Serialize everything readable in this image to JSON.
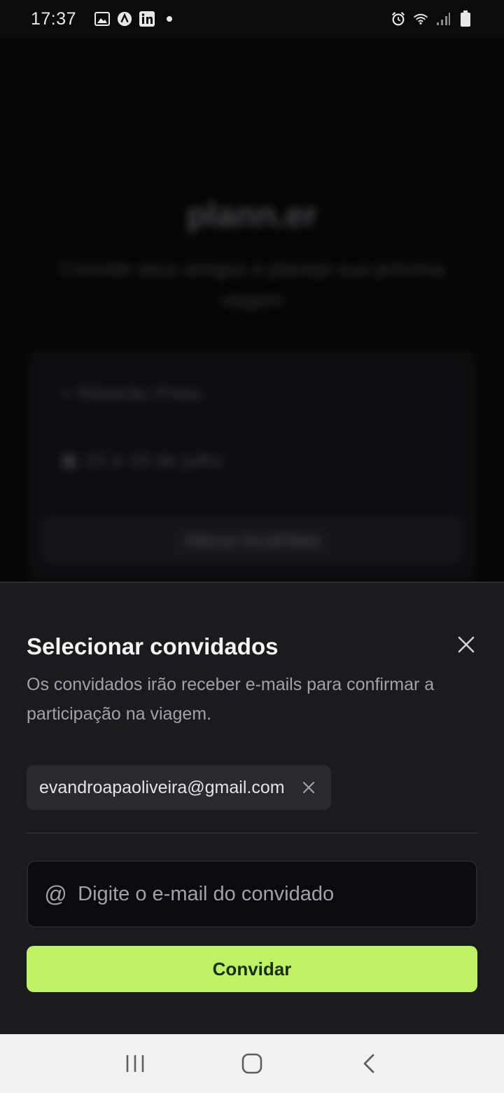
{
  "status_bar": {
    "time": "17:37",
    "left_icons": [
      "image-icon",
      "app-icon",
      "linkedin-icon",
      "dot-icon"
    ],
    "right_icons": [
      "alarm-icon",
      "wifi-icon",
      "signal-icon",
      "battery-icon"
    ]
  },
  "background_app": {
    "logo_text": "plann.er",
    "subtitle": "Convide seus amigos e planeje sua próxima viagem",
    "destination": "Ribeirão Preto",
    "dates": "15 à 18 de julho",
    "change_button": "Alterar local/data"
  },
  "sheet": {
    "title": "Selecionar convidados",
    "description": "Os convidados irão receber e-mails para confirmar a participação na viagem.",
    "guests": [
      {
        "email": "evandroapaoliveira@gmail.com"
      }
    ],
    "email_input": {
      "value": "",
      "placeholder": "Digite o e-mail do convidado"
    },
    "invite_button": "Convidar",
    "accent_color": "#bef264"
  },
  "nav_bar": {
    "buttons": [
      "recent-apps",
      "home",
      "back"
    ]
  }
}
